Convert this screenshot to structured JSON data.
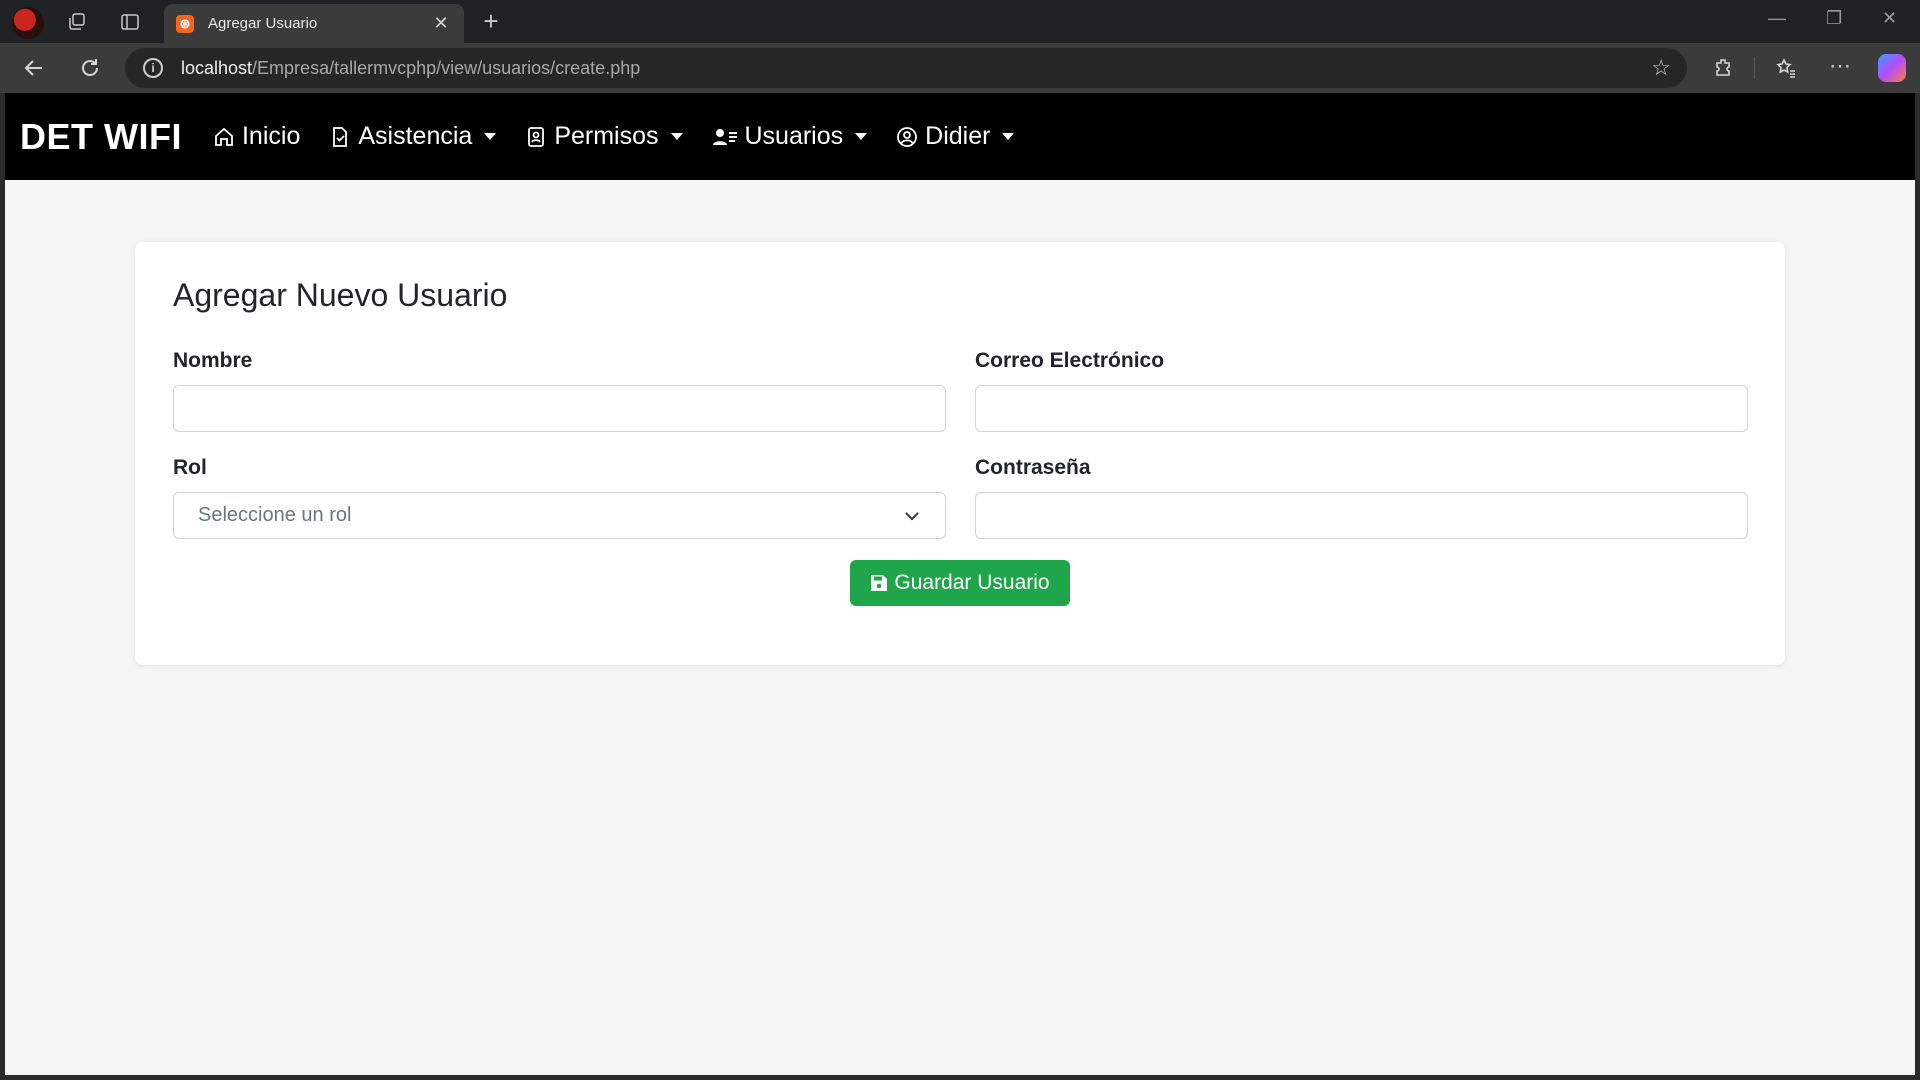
{
  "browser": {
    "tab_title": "Agregar Usuario",
    "url_host": "localhost",
    "url_path": "/Empresa/tallermvcphp/view/usuarios/create.php"
  },
  "navbar": {
    "brand": "DET WIFI",
    "items": [
      {
        "label": "Inicio",
        "icon": "home-icon",
        "dropdown": false
      },
      {
        "label": "Asistencia",
        "icon": "clipboard-check-icon",
        "dropdown": true
      },
      {
        "label": "Permisos",
        "icon": "badge-icon",
        "dropdown": true
      },
      {
        "label": "Usuarios",
        "icon": "users-list-icon",
        "dropdown": true
      },
      {
        "label": "Didier",
        "icon": "user-circle-icon",
        "dropdown": true
      }
    ]
  },
  "form": {
    "title": "Agregar Nuevo Usuario",
    "nombre_label": "Nombre",
    "nombre_value": "",
    "correo_label": "Correo Electrónico",
    "correo_value": "",
    "rol_label": "Rol",
    "rol_selected": "Seleccione un rol",
    "password_label": "Contraseña",
    "password_value": "",
    "submit_label": "Guardar Usuario"
  },
  "colors": {
    "navbar_bg": "#000000",
    "page_bg": "#f4f5f4",
    "button_green": "#1fa64a"
  }
}
